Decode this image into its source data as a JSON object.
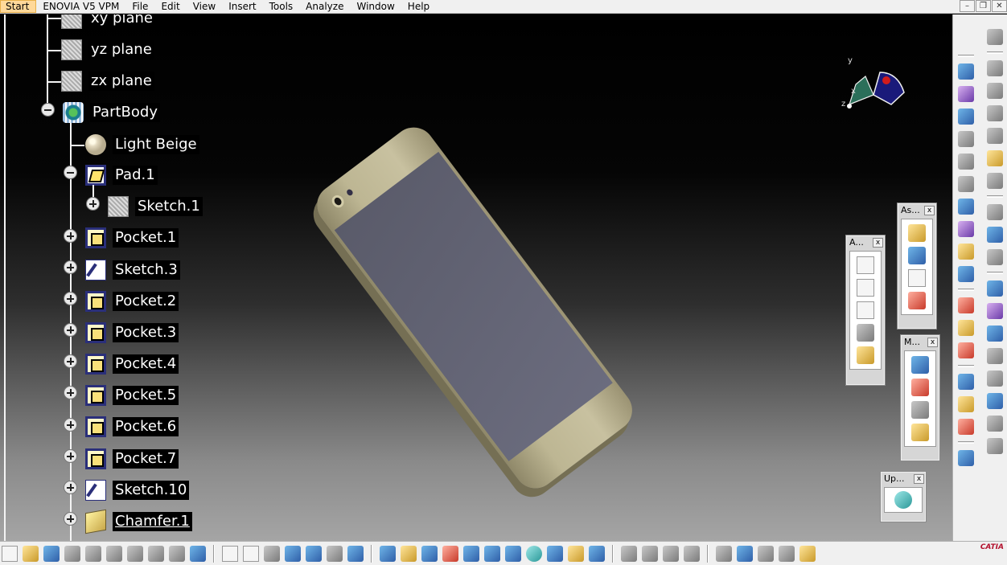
{
  "menubar": {
    "start": "Start",
    "items": [
      "ENOVIA V5 VPM",
      "File",
      "Edit",
      "View",
      "Insert",
      "Tools",
      "Analyze",
      "Window",
      "Help"
    ]
  },
  "tree": {
    "planes": [
      "xy plane",
      "yz plane",
      "zx plane"
    ],
    "part_body": "PartBody",
    "material": "Light Beige",
    "pad": "Pad.1",
    "pad_sketch": "Sketch.1",
    "features": [
      "Pocket.1",
      "Sketch.3",
      "Pocket.2",
      "Pocket.3",
      "Pocket.4",
      "Pocket.5",
      "Pocket.6",
      "Pocket.7",
      "Sketch.10",
      "Chamfer.1"
    ]
  },
  "compass": {
    "x": "x",
    "y": "y",
    "z": "z"
  },
  "floating_toolbars": {
    "annotations": {
      "title": "A...",
      "close": "x"
    },
    "assembly": {
      "title": "As...",
      "close": "x"
    },
    "measure": {
      "title": "M...",
      "close": "x"
    },
    "update": {
      "title": "Up...",
      "close": "x"
    }
  },
  "branding": {
    "logo": "CATIA"
  },
  "colors": {
    "menu_start": "#ffd99a",
    "phone_body": "#bdb693",
    "phone_screen": "#5a5b6a"
  }
}
